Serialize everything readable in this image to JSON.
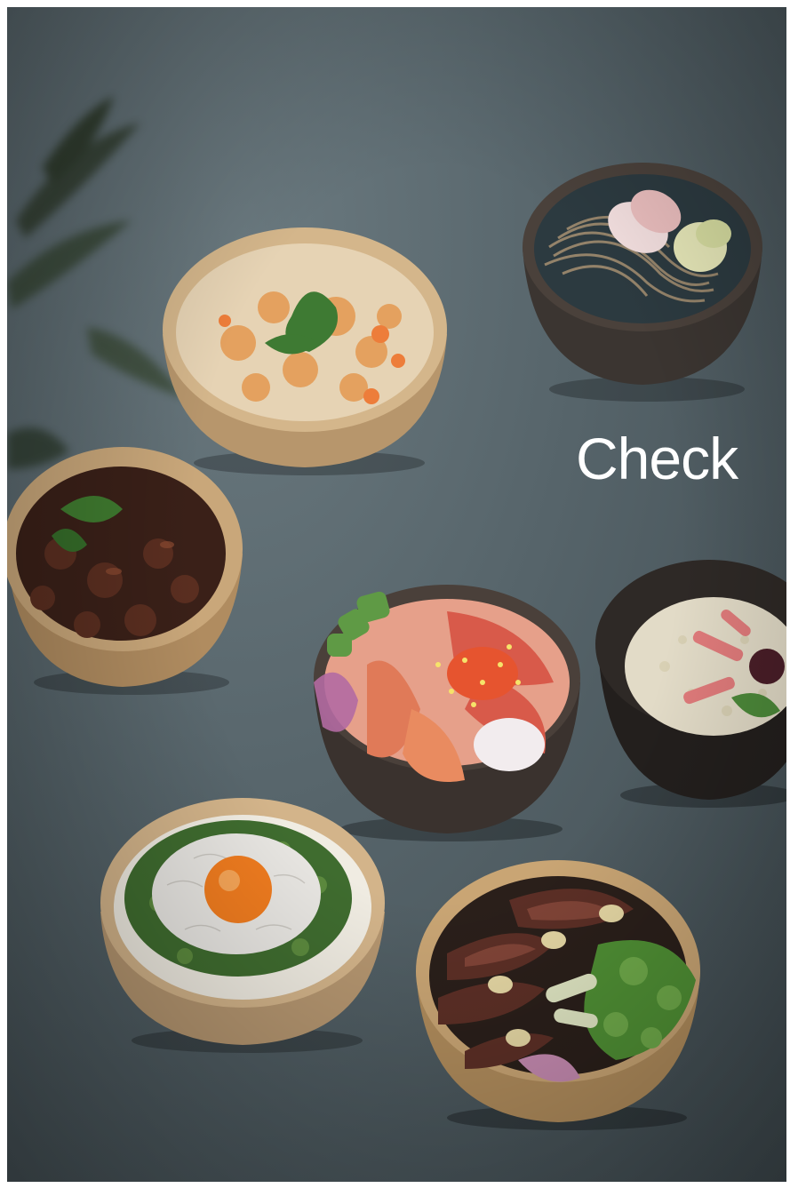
{
  "overlay": {
    "heading": "Check"
  },
  "colors": {
    "background": "#56646a",
    "wooden_bowl": "#c9a77a",
    "dark_bowl": "#2f2b29"
  },
  "scene": {
    "dishes": [
      "soba-noodle-bowl",
      "shrimp-rice-bowl",
      "mushroom-stew-bowl",
      "seafood-sashimi-bowl",
      "crab-rice-bowl",
      "shirasu-egg-yolk-bowl",
      "steak-rice-bowl"
    ]
  }
}
